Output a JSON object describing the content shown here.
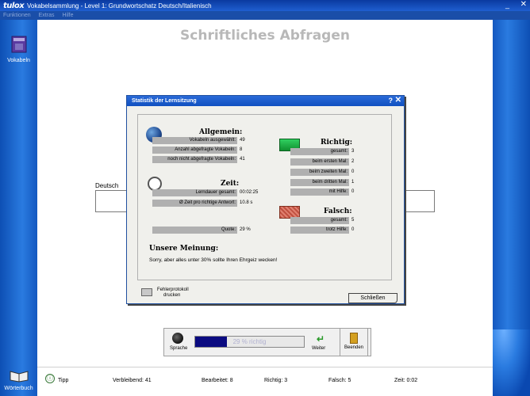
{
  "window": {
    "logo": "tulox",
    "title": "Vokabelsammlung - Level 1: Grundwortschatz Deutsch/Italienisch",
    "minimize_glyph": "_",
    "close_glyph": "✕"
  },
  "menu": [
    "Funktionen",
    "Extras",
    "Hilfe"
  ],
  "sidebar": {
    "vokabeln_label": "Vokabeln",
    "woerterbuch_label": "Wörterbuch"
  },
  "main": {
    "page_title": "Schriftliches Abfragen",
    "deutsch_label": "Deutsch"
  },
  "controls": {
    "sprache_label": "Sprache",
    "progress_text": "29 % richtig",
    "progress_percent": 29,
    "weiter_label": "Weiter",
    "beenden_label": "Beenden"
  },
  "status": {
    "tipp": "Tipp",
    "verbleibend": "Verbleibend: 41",
    "bearbeitet": "Bearbeitet: 8",
    "richtig": "Richtig: 3",
    "falsch": "Falsch: 5",
    "zeit": "Zeit: 0:02"
  },
  "dialog": {
    "title": "Statistik der Lernsitzung",
    "help_glyph": "?",
    "close_glyph": "✕",
    "allgemein": {
      "heading": "Allgemein:",
      "rows": [
        {
          "label": "Vokabeln ausgewählt:",
          "value": "49"
        },
        {
          "label": "Anzahl abgefragte Vokabeln:",
          "value": "8"
        },
        {
          "label": "noch nicht abgefragte Vokabeln:",
          "value": "41"
        }
      ]
    },
    "zeit": {
      "heading": "Zeit:",
      "rows": [
        {
          "label": "Lerndauer gesamt:",
          "value": "00:02:25"
        },
        {
          "label": "Ø  Zeit pro richtige Antwort:",
          "value": "10.8 s"
        }
      ]
    },
    "quote": {
      "label": "Quote:",
      "value": "29 %"
    },
    "richtig": {
      "heading": "Richtig:",
      "rows": [
        {
          "label": "gesamt:",
          "value": "3"
        },
        {
          "label": "beim ersten Mal:",
          "value": "2"
        },
        {
          "label": "beim zweiten Mal:",
          "value": "0"
        },
        {
          "label": "beim dritten Mal:",
          "value": "1"
        },
        {
          "label": "mit Hilfe:",
          "value": "0"
        }
      ]
    },
    "falsch": {
      "heading": "Falsch:",
      "rows": [
        {
          "label": "gesamt:",
          "value": "5"
        },
        {
          "label": "trotz Hilfe:",
          "value": "0"
        }
      ]
    },
    "meinung": {
      "heading": "Unsere Meinung:",
      "text": "Sorry, aber alles unter 30% sollte Ihren Ehrgeiz wecken!"
    },
    "print_label_line1": "Fehlerprotokoll",
    "print_label_line2": "drucken",
    "close_button": "Schließen"
  }
}
